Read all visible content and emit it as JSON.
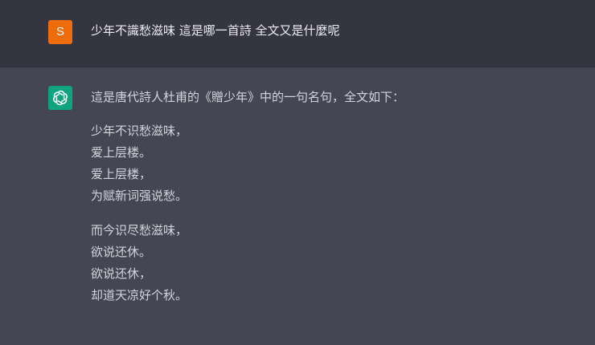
{
  "conversation": {
    "user": {
      "avatar_initial": "S",
      "avatar_color": "#ef6c0a",
      "message": "少年不識愁滋味 這是哪一首詩 全文又是什麼呢"
    },
    "assistant": {
      "avatar_icon": "openai-logo-icon",
      "avatar_color": "#10a37f",
      "intro": "這是唐代詩人杜甫的《贈少年》中的一句名句，全文如下：",
      "stanzas": [
        [
          "少年不识愁滋味，",
          "爱上层楼。",
          "爱上层楼，",
          "为赋新词强说愁。"
        ],
        [
          "而今识尽愁滋味，",
          "欲说还休。",
          "欲说还休，",
          "却道天凉好个秋。"
        ]
      ]
    }
  },
  "colors": {
    "user_row_bg": "#343541",
    "assistant_row_bg": "#444654",
    "text": "#ececf1"
  }
}
